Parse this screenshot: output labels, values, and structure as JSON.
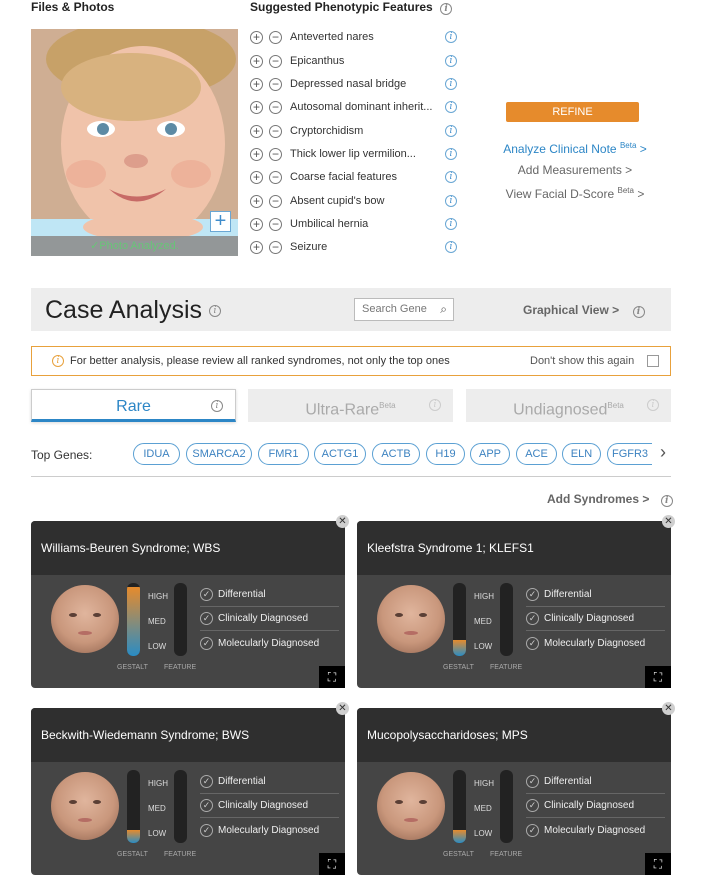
{
  "files": {
    "title": "Files & Photos",
    "photo_status": "Photo Analyzed."
  },
  "features": {
    "title": "Suggested Phenotypic Features",
    "items": [
      "Anteverted nares",
      "Epicanthus",
      "Depressed nasal bridge",
      "Autosomal dominant inherit...",
      "Cryptorchidism",
      "Thick lower lip vermilion...",
      "Coarse facial features",
      "Absent cupid's bow",
      "Umbilical hernia",
      "Seizure"
    ]
  },
  "actions": {
    "refine": "REFINE",
    "analyze_note": "Analyze Clinical Note",
    "analyze_badge": "Beta",
    "analyze_arrow": ">",
    "add_measurements": "Add Measurements >",
    "view_dscore": "View Facial D-Score",
    "view_badge": "Beta",
    "view_arrow": ">"
  },
  "case": {
    "title": "Case Analysis",
    "search_placeholder": "Search Gene",
    "graphical_view": "Graphical View >"
  },
  "notice": {
    "text": "For better analysis, please review all ranked syndromes, not only the top ones",
    "dismiss": "Don't show this again"
  },
  "tabs": [
    {
      "label": "Rare",
      "badge": ""
    },
    {
      "label": "Ultra-Rare",
      "badge": "Beta"
    },
    {
      "label": "Undiagnosed",
      "badge": "Beta"
    }
  ],
  "genes": {
    "label": "Top Genes:",
    "items": [
      "IDUA",
      "SMARCA2",
      "FMR1",
      "ACTG1",
      "ACTB",
      "H19",
      "APP",
      "ACE",
      "ELN",
      "FGFR3"
    ]
  },
  "add_syndromes": "Add Syndromes >",
  "levels": {
    "high": "HIGH",
    "med": "MED",
    "low": "LOW",
    "gestalt": "GESTALT",
    "feature": "FEATURE"
  },
  "diagnosis_labels": [
    "Differential",
    "Clinically Diagnosed",
    "Molecularly Diagnosed"
  ],
  "syndromes": [
    {
      "name": "Williams-Beuren Syndrome; WBS",
      "gestalt_level": 0.95,
      "feature_level": 0
    },
    {
      "name": "Kleefstra Syndrome 1; KLEFS1",
      "gestalt_level": 0.22,
      "feature_level": 0
    },
    {
      "name": "Beckwith-Wiedemann Syndrome; BWS",
      "gestalt_level": 0.18,
      "feature_level": 0
    },
    {
      "name": "Mucopolysaccharidoses; MPS",
      "gestalt_level": 0.18,
      "feature_level": 0
    }
  ],
  "colors": {
    "accent": "#2c86c6",
    "refine": "#e68b2c",
    "photo_ok": "#5fc26a"
  }
}
